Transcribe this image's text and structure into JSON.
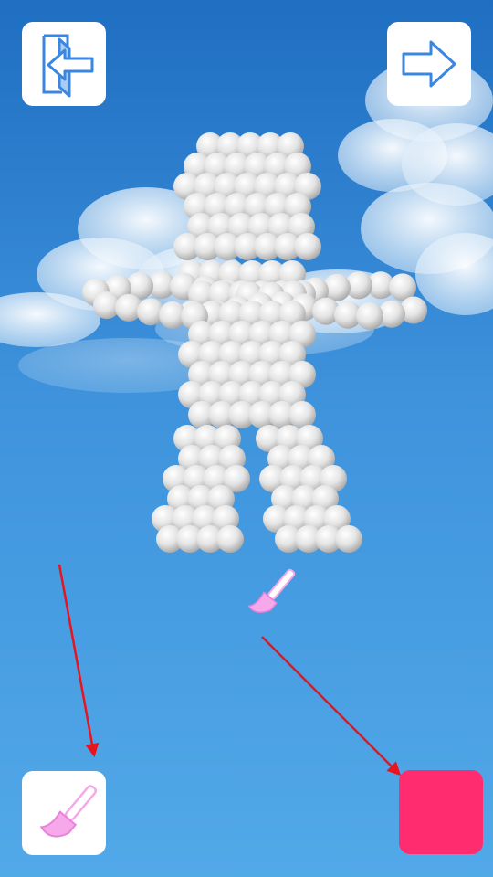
{
  "scene": {
    "sky_top": "#1f6ec2",
    "sky_bottom": "#52a9e8",
    "figure_color": "#e6e6e6",
    "figure_shadow": "#b9b9b9"
  },
  "toolbar": {
    "back_icon": "exit-door-left-arrow-icon",
    "next_icon": "right-arrow-icon",
    "brush_icon": "paint-brush-icon",
    "ui_color": "#3a86e0",
    "brush_color": "#f6a8ea"
  },
  "selected_color": {
    "hex": "#ff2d6f"
  },
  "hint_arrows": {
    "color": "#e8141e"
  }
}
